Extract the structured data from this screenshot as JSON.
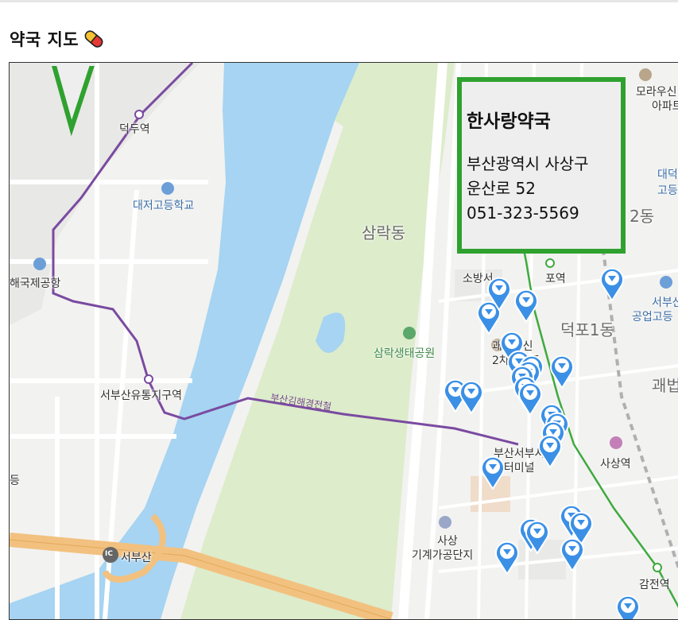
{
  "page": {
    "title": "약국 지도",
    "title_icon": "pill-icon"
  },
  "map": {
    "labels": {
      "deokdu_station": "덕두역",
      "daejeo_highschool": "대저고등학교",
      "gimhae_airport": "해국제공항",
      "seobusan_logistics": "서부산유통지구역",
      "samnak_dong": "삼락동",
      "samnak_park": "삼락생태공원",
      "busan_gimhae_line": "부산김해경전철",
      "sasang_industrial": "사상",
      "sasang_industrial2": "기계가공단지",
      "seobusan_ic": "서부산",
      "ic_badge": "IC",
      "deokpo1dong": "덕포1동",
      "deokpo_station": "포역",
      "fire_station": "소방서",
      "gwaebeop_apt": "괘법한신",
      "gwaebeop_apt2": "2차아파트",
      "seobu_terminal": "부산서부시",
      "seobu_terminal2": "스터미널",
      "sasang_station": "사상역",
      "gamjeon_station": "감전역",
      "morae_apt": "모라우신",
      "morae_apt2": "아파트",
      "daedeok": "대덕",
      "daedeok2": "고등",
      "dong2": "2동",
      "seobu_industrial": "서부산",
      "seobu_industrial2": "공업고등",
      "gwaebeop": "괘법",
      "left_edge": "등"
    },
    "colors": {
      "water": "#a6d4f2",
      "park": "#ddeccb",
      "urban": "#f1f1ef",
      "road": "#ffffff",
      "highway": "#f2c17f",
      "subway": "#7a4aa0",
      "line2": "#3faa3f",
      "marker": "#3b90e6",
      "popup_border": "#2fa12f"
    },
    "marker_count": 26,
    "marker_icon": "location-pin-icon"
  },
  "popup": {
    "name": "한사랑약국",
    "address_line1": "부산광역시 사상구",
    "address_line2": "운산로 52",
    "phone": "051-323-5569"
  }
}
